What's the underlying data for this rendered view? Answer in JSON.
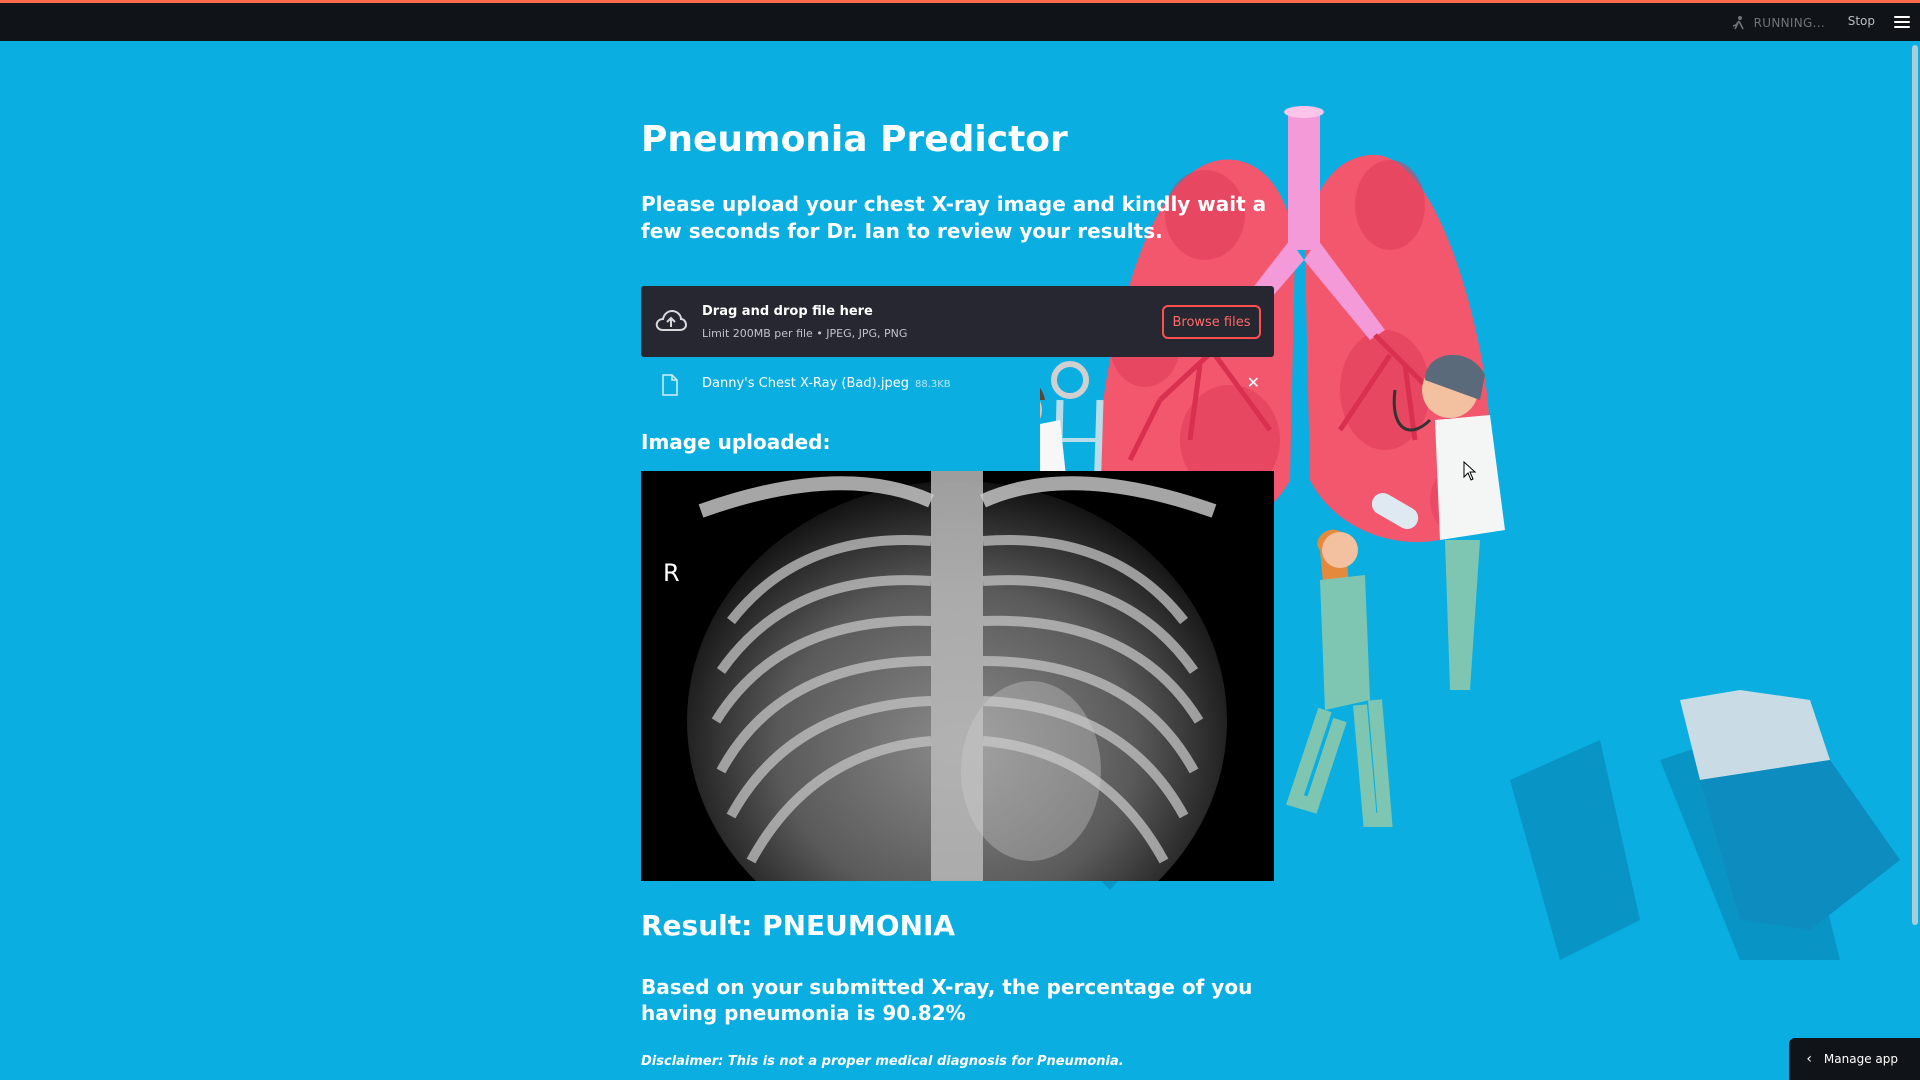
{
  "header": {
    "status_text": "RUNNING...",
    "stop_label": "Stop"
  },
  "main": {
    "title": "Pneumonia Predictor",
    "subtitle": "Please upload your chest X-ray image and kindly wait a few seconds for Dr. Ian to review your results.",
    "uploader": {
      "drop_text": "Drag and drop file here",
      "limit_text": "Limit 200MB per file • JPEG, JPG, PNG",
      "browse_label": "Browse files"
    },
    "uploaded_file": {
      "name": "Danny's Chest X-Ray (Bad).jpeg",
      "size": "88.3KB",
      "remove_glyph": "✕"
    },
    "image_label": "Image uploaded:",
    "xray_marker": "R",
    "result_title": "Result: PNEUMONIA",
    "result_text": "Based on your submitted X-ray, the percentage of you having pneumonia is 90.82%",
    "disclaimer": "Disclaimer: This is not a proper medical diagnosis for Pneumonia."
  },
  "footer": {
    "manage_label": "Manage app"
  },
  "colors": {
    "background": "#0aaee0",
    "topbar": "#101418",
    "uploader_bg": "#262730",
    "accent_red": "#ff5050",
    "lung": "#f2576e",
    "trachea": "#f49ad8"
  },
  "icons": {
    "running": "running-person-icon",
    "menu": "hamburger-menu-icon",
    "upload": "cloud-upload-icon",
    "file": "file-icon",
    "close": "close-icon",
    "manage": "chevron-left-icon"
  }
}
